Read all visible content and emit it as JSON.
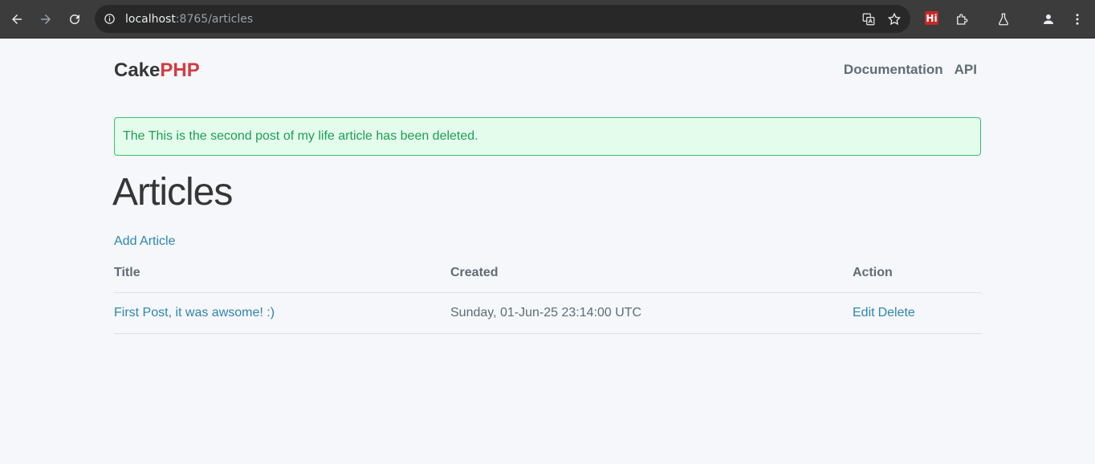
{
  "browser": {
    "url_host": "localhost",
    "url_rest": ":8765/articles",
    "icons": [
      "back-icon",
      "forward-icon",
      "reload-icon",
      "info-icon",
      "translate-icon",
      "star-icon",
      "puzzle-icon",
      "lab-icon",
      "profile-icon",
      "menu-icon"
    ],
    "extension_label": "Hi"
  },
  "header": {
    "brand_cake": "Cake",
    "brand_php": "PHP",
    "brand_accent_color": "#d33c43",
    "links": [
      "Documentation",
      "API"
    ]
  },
  "flash": {
    "message": "The This is the second post of my life article has been deleted.",
    "type": "success"
  },
  "main": {
    "title": "Articles",
    "add_link": "Add Article",
    "table": {
      "headers": [
        "Title",
        "Created",
        "Action"
      ],
      "rows": [
        {
          "title": "First Post, it was awsome! :)",
          "created": "Sunday, 01-Jun-25 23:14:00 UTC",
          "edit": "Edit",
          "delete": "Delete"
        }
      ]
    }
  }
}
